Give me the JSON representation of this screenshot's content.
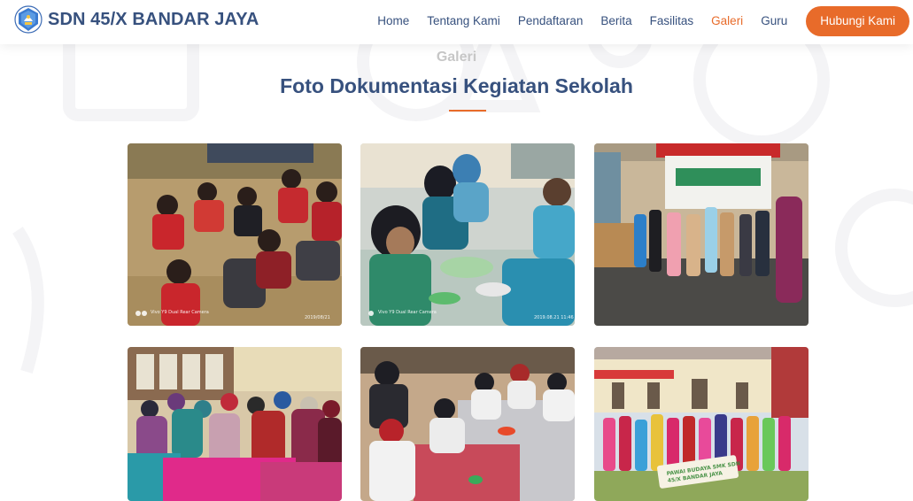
{
  "header": {
    "brand_name": "SDN 45/X BANDAR JAYA",
    "logo_icon": "school-emblem-icon",
    "nav": [
      {
        "label": "Home",
        "active": false
      },
      {
        "label": "Tentang Kami",
        "active": false
      },
      {
        "label": "Pendaftaran",
        "active": false
      },
      {
        "label": "Berita",
        "active": false
      },
      {
        "label": "Fasilitas",
        "active": false
      },
      {
        "label": "Galeri",
        "active": true
      },
      {
        "label": "Guru",
        "active": false
      }
    ],
    "cta_label": "Hubungi Kami"
  },
  "section": {
    "label": "Galeri",
    "title": "Foto Dokumentasi Kegiatan Sekolah"
  },
  "gallery": {
    "photos": [
      {
        "subject": "students-sitting-on-grass",
        "stamp_left": "Vivo Y9  Dual Rear Camera",
        "stamp_right": "2019/08/21"
      },
      {
        "subject": "mothers-eating-together-outdoors",
        "stamp_left": "Vivo Y9  Dual Rear Camera",
        "stamp_right": "2019.08.21 11:46"
      },
      {
        "subject": "children-costume-show-in-hall",
        "stamp_left": "",
        "stamp_right": ""
      },
      {
        "subject": "parents-in-classroom",
        "stamp_left": "",
        "stamp_right": ""
      },
      {
        "subject": "students-eating-on-mat",
        "stamp_left": "",
        "stamp_right": ""
      },
      {
        "subject": "students-in-costumes-group-photo",
        "banner": "PAWAI BUDAYA SMK SDN 45/X BANDAR JAYA"
      }
    ]
  },
  "colors": {
    "brand": "#37517e",
    "accent": "#e86b2a",
    "muted": "#c7c7c7"
  }
}
